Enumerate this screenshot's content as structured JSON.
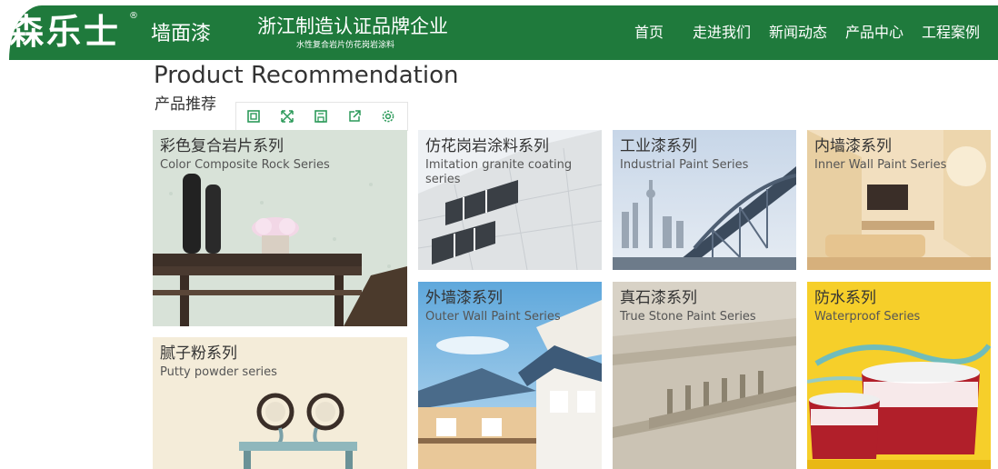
{
  "header": {
    "logo": "森乐士",
    "registered": "®",
    "product_name": "墙面漆",
    "slogan": "浙江制造认证品牌企业",
    "slogan_sub": "水性复合岩片仿花岗岩涂料",
    "nav": [
      "首页",
      "走进我们",
      "新闻动态",
      "产品中心",
      "工程案例"
    ]
  },
  "section": {
    "title_en": "Product Recommendation",
    "title_cn": "产品推荐"
  },
  "toolbar": {
    "icons": [
      "frame-icon",
      "expand-icon",
      "save-icon",
      "share-icon",
      "settings-icon"
    ]
  },
  "cards": [
    {
      "cn": "彩色复合岩片系列",
      "en": "Color Composite Rock Series"
    },
    {
      "cn": "仿花岗岩涂料系列",
      "en": "Imitation granite coating series"
    },
    {
      "cn": "工业漆系列",
      "en": "Industrial Paint Series"
    },
    {
      "cn": "内墙漆系列",
      "en": "Inner Wall Paint Series"
    },
    {
      "cn": "腻子粉系列",
      "en": "Putty powder series"
    },
    {
      "cn": "外墙漆系列",
      "en": "Outer Wall Paint Series"
    },
    {
      "cn": "真石漆系列",
      "en": "True Stone Paint Series"
    },
    {
      "cn": "防水系列",
      "en": "Waterproof Series"
    }
  ],
  "colors": {
    "brand_green": "#1f7a3c",
    "toolbar_icon": "#2c9a5a"
  }
}
